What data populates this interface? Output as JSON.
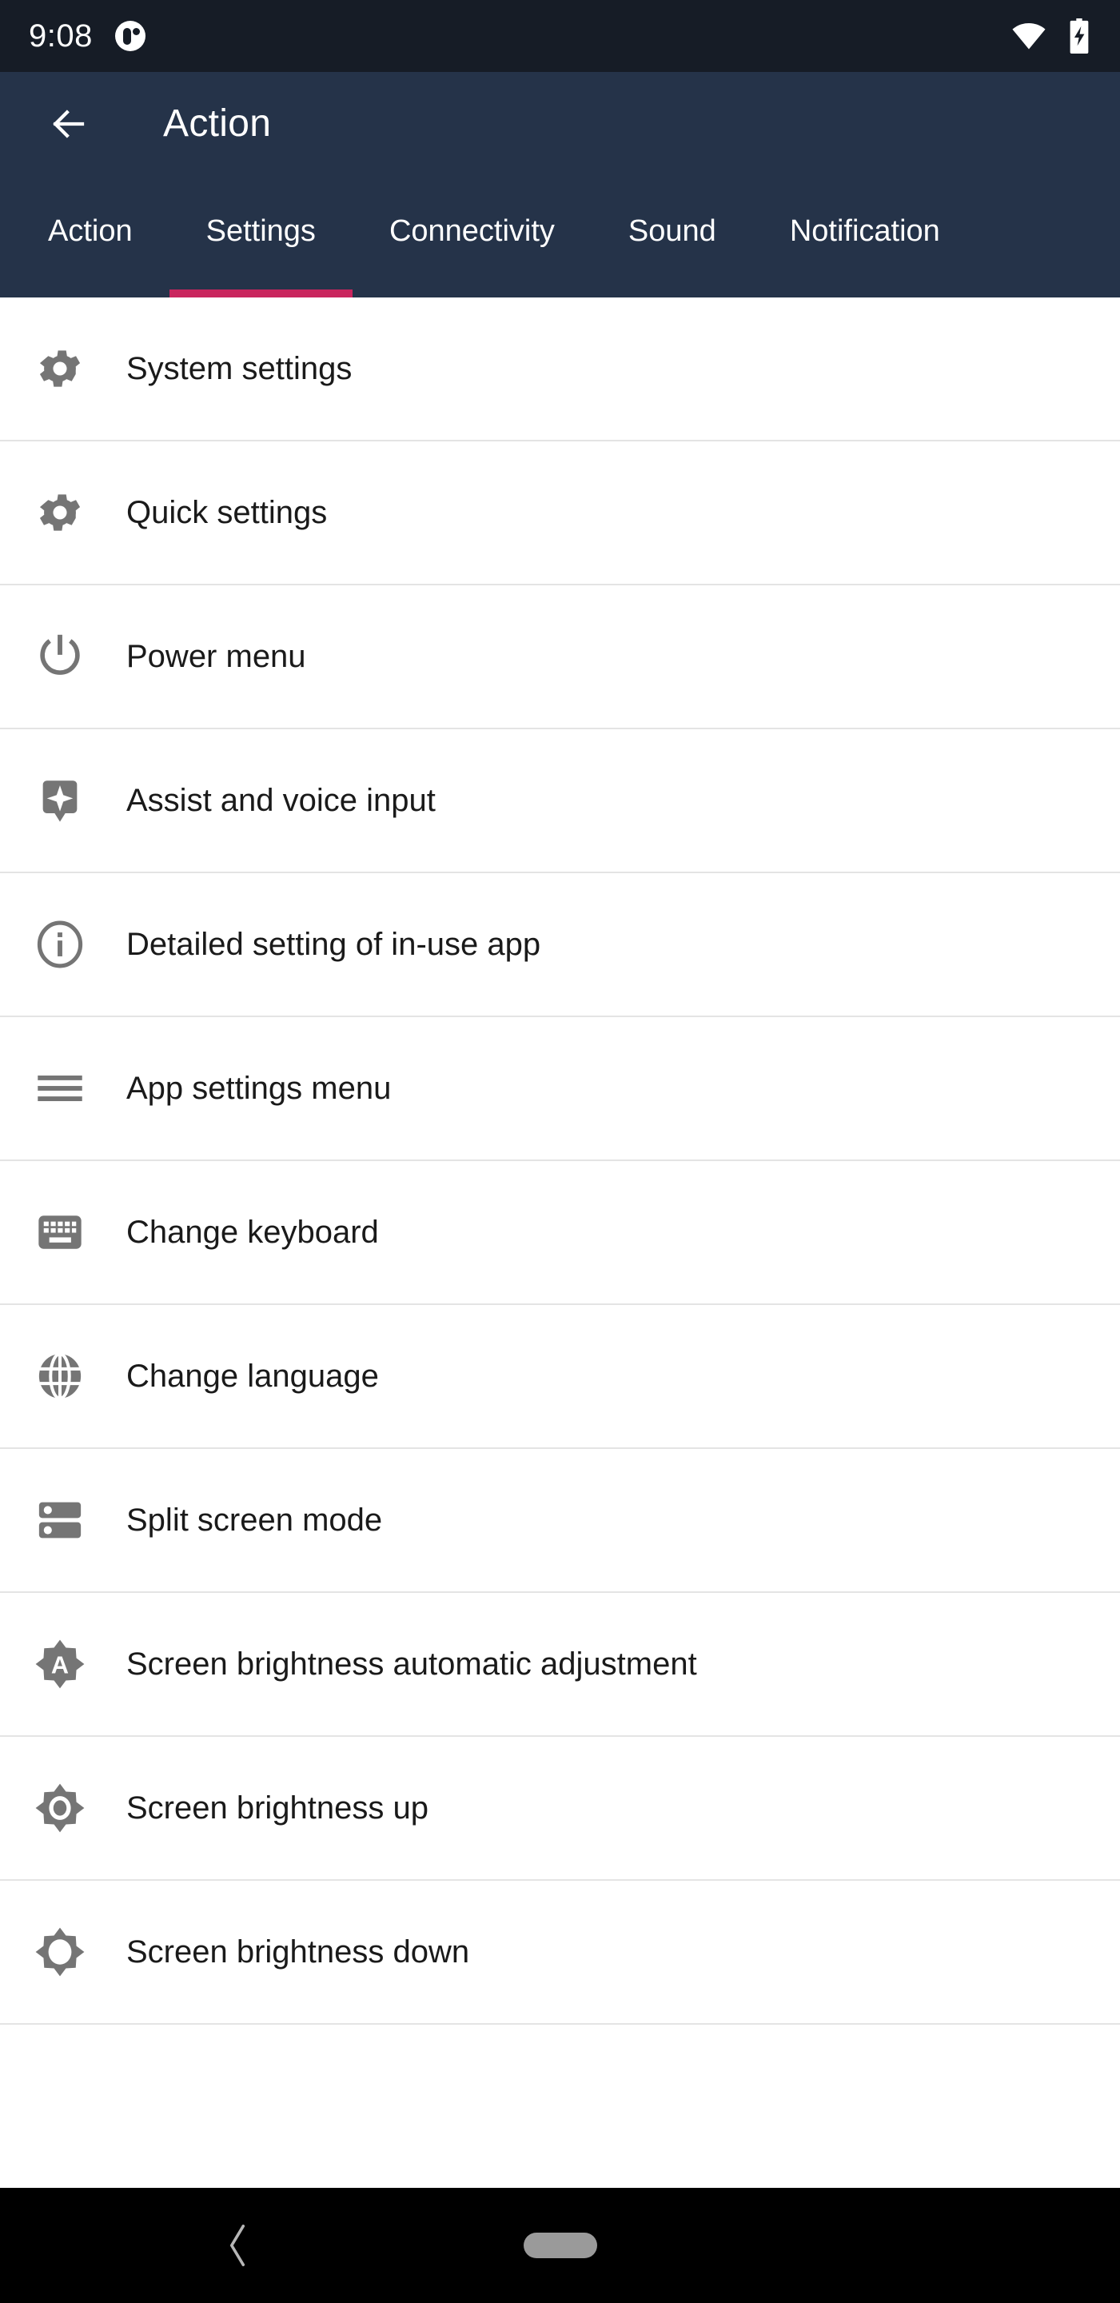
{
  "status_bar": {
    "clock": "9:08",
    "notification_icon": "app-notification-icon",
    "wifi_icon": "wifi-full-icon",
    "battery_icon": "battery-charging-icon",
    "background_color": "#161c26"
  },
  "app_bar": {
    "back_icon": "back-arrow-icon",
    "title": "Action",
    "background_color": "#253349"
  },
  "tabs": {
    "active_index": 1,
    "indicator_color": "#c9265e",
    "items": [
      {
        "label": "Action"
      },
      {
        "label": "Settings"
      },
      {
        "label": "Connectivity"
      },
      {
        "label": "Sound"
      },
      {
        "label": "Notification"
      }
    ]
  },
  "list": {
    "icon_color": "#757575",
    "rows": [
      {
        "icon": "gear-icon",
        "label": "System settings"
      },
      {
        "icon": "gear-icon",
        "label": "Quick settings"
      },
      {
        "icon": "power-icon",
        "label": "Power menu"
      },
      {
        "icon": "assist-sparkle-icon",
        "label": "Assist and voice input"
      },
      {
        "icon": "info-circle-icon",
        "label": "Detailed setting of in-use app"
      },
      {
        "icon": "hamburger-menu-icon",
        "label": "App settings menu"
      },
      {
        "icon": "keyboard-icon",
        "label": "Change keyboard"
      },
      {
        "icon": "globe-icon",
        "label": "Change language"
      },
      {
        "icon": "split-screen-icon",
        "label": "Split screen mode"
      },
      {
        "icon": "brightness-auto-icon",
        "label": "Screen brightness automatic adjustment"
      },
      {
        "icon": "brightness-up-icon",
        "label": "Screen brightness up"
      },
      {
        "icon": "brightness-down-icon",
        "label": "Screen brightness down"
      }
    ]
  },
  "nav_bar": {
    "back_icon": "nav-back-chevron-icon",
    "home_icon": "nav-home-pill-icon",
    "background_color": "#000000"
  }
}
